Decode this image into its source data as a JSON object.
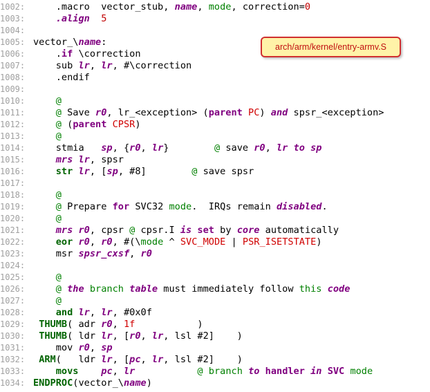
{
  "file_label": "arch/arm/kernel/entry-armv.S",
  "lines": [
    {
      "n": "1002:",
      "t": [
        [
          "p",
          "    .macro  vector_stub, "
        ],
        [
          "ri",
          "name"
        ],
        [
          "p",
          ", "
        ],
        [
          "g",
          "mode"
        ],
        [
          "p",
          ", correction="
        ],
        [
          "num",
          "0"
        ]
      ]
    },
    {
      "n": "1003:",
      "t": [
        [
          "p",
          "    "
        ],
        [
          "ri",
          ".align"
        ],
        [
          "p",
          "  "
        ],
        [
          "num",
          "5"
        ]
      ]
    },
    {
      "n": "1004:",
      "t": []
    },
    {
      "n": "1005:",
      "t": [
        [
          "p",
          "vector_\\"
        ],
        [
          "ri",
          "name"
        ],
        [
          "p",
          ":"
        ]
      ]
    },
    {
      "n": "1006:",
      "t": [
        [
          "p",
          "    ."
        ],
        [
          "pb",
          "if"
        ],
        [
          "p",
          " \\correction"
        ]
      ]
    },
    {
      "n": "1007:",
      "t": [
        [
          "p",
          "    sub "
        ],
        [
          "ri",
          "lr"
        ],
        [
          "p",
          ", "
        ],
        [
          "ri",
          "lr"
        ],
        [
          "p",
          ", #\\correction"
        ]
      ]
    },
    {
      "n": "1008:",
      "t": [
        [
          "p",
          "    .endif"
        ]
      ]
    },
    {
      "n": "1009:",
      "t": []
    },
    {
      "n": "1010:",
      "t": [
        [
          "p",
          "    "
        ],
        [
          "g",
          "@"
        ]
      ]
    },
    {
      "n": "1011:",
      "t": [
        [
          "p",
          "    "
        ],
        [
          "g",
          "@"
        ],
        [
          "p",
          " Save "
        ],
        [
          "ri",
          "r0"
        ],
        [
          "p",
          ", lr_<exception> ("
        ],
        [
          "pb",
          "parent"
        ],
        [
          "p",
          " "
        ],
        [
          "red",
          "PC"
        ],
        [
          "p",
          ") "
        ],
        [
          "ri",
          "and"
        ],
        [
          "p",
          " spsr_<exception>"
        ]
      ]
    },
    {
      "n": "1012:",
      "t": [
        [
          "p",
          "    "
        ],
        [
          "g",
          "@"
        ],
        [
          "p",
          " ("
        ],
        [
          "pb",
          "parent"
        ],
        [
          "p",
          " "
        ],
        [
          "red",
          "CPSR"
        ],
        [
          "p",
          ")"
        ]
      ]
    },
    {
      "n": "1013:",
      "t": [
        [
          "p",
          "    "
        ],
        [
          "g",
          "@"
        ]
      ]
    },
    {
      "n": "1014:",
      "t": [
        [
          "p",
          "    stmia   "
        ],
        [
          "ri",
          "sp"
        ],
        [
          "p",
          ", {"
        ],
        [
          "ri",
          "r0"
        ],
        [
          "p",
          ", "
        ],
        [
          "ri",
          "lr"
        ],
        [
          "p",
          "}        "
        ],
        [
          "g",
          "@"
        ],
        [
          "p",
          " save "
        ],
        [
          "ri",
          "r0"
        ],
        [
          "p",
          ", "
        ],
        [
          "ri",
          "lr"
        ],
        [
          "p",
          " "
        ],
        [
          "ri",
          "to"
        ],
        [
          "p",
          " "
        ],
        [
          "ri",
          "sp"
        ]
      ]
    },
    {
      "n": "1015:",
      "t": [
        [
          "p",
          "    "
        ],
        [
          "ri",
          "mrs"
        ],
        [
          "p",
          " "
        ],
        [
          "ri",
          "lr"
        ],
        [
          "p",
          ", spsr"
        ]
      ]
    },
    {
      "n": "1016:",
      "t": [
        [
          "p",
          "    "
        ],
        [
          "gb",
          "str"
        ],
        [
          "p",
          " "
        ],
        [
          "ri",
          "lr"
        ],
        [
          "p",
          ", ["
        ],
        [
          "ri",
          "sp"
        ],
        [
          "p",
          ", #8]        "
        ],
        [
          "g",
          "@"
        ],
        [
          "p",
          " save spsr"
        ]
      ]
    },
    {
      "n": "1017:",
      "t": []
    },
    {
      "n": "1018:",
      "t": [
        [
          "p",
          "    "
        ],
        [
          "g",
          "@"
        ]
      ]
    },
    {
      "n": "1019:",
      "t": [
        [
          "p",
          "    "
        ],
        [
          "g",
          "@"
        ],
        [
          "p",
          " Prepare "
        ],
        [
          "pb",
          "for"
        ],
        [
          "p",
          " SVC32 "
        ],
        [
          "g",
          "mode"
        ],
        [
          "p",
          ".  IRQs remain "
        ],
        [
          "ri",
          "disabled"
        ],
        [
          "p",
          "."
        ]
      ]
    },
    {
      "n": "1020:",
      "t": [
        [
          "p",
          "    "
        ],
        [
          "g",
          "@"
        ]
      ]
    },
    {
      "n": "1021:",
      "t": [
        [
          "p",
          "    "
        ],
        [
          "ri",
          "mrs"
        ],
        [
          "p",
          " "
        ],
        [
          "ri",
          "r0"
        ],
        [
          "p",
          ", cpsr "
        ],
        [
          "g",
          "@"
        ],
        [
          "p",
          " cpsr.I "
        ],
        [
          "ri",
          "is"
        ],
        [
          "p",
          " "
        ],
        [
          "pb",
          "set"
        ],
        [
          "p",
          " by "
        ],
        [
          "ri",
          "core"
        ],
        [
          "p",
          " automatically"
        ]
      ]
    },
    {
      "n": "1022:",
      "t": [
        [
          "p",
          "    "
        ],
        [
          "gb",
          "eor"
        ],
        [
          "p",
          " "
        ],
        [
          "ri",
          "r0"
        ],
        [
          "p",
          ", "
        ],
        [
          "ri",
          "r0"
        ],
        [
          "p",
          ", #(\\"
        ],
        [
          "g",
          "mode"
        ],
        [
          "p",
          " ^ "
        ],
        [
          "red",
          "SVC_MODE"
        ],
        [
          "p",
          " | "
        ],
        [
          "red",
          "PSR_ISETSTATE"
        ],
        [
          "p",
          ")"
        ]
      ]
    },
    {
      "n": "1023:",
      "t": [
        [
          "p",
          "    msr "
        ],
        [
          "ri",
          "spsr_cxsf"
        ],
        [
          "p",
          ", "
        ],
        [
          "ri",
          "r0"
        ]
      ]
    },
    {
      "n": "1024:",
      "t": []
    },
    {
      "n": "1025:",
      "t": [
        [
          "p",
          "    "
        ],
        [
          "g",
          "@"
        ]
      ]
    },
    {
      "n": "1026:",
      "t": [
        [
          "p",
          "    "
        ],
        [
          "g",
          "@"
        ],
        [
          "p",
          " "
        ],
        [
          "ri",
          "the"
        ],
        [
          "p",
          " "
        ],
        [
          "g",
          "branch"
        ],
        [
          "p",
          " "
        ],
        [
          "ri",
          "table"
        ],
        [
          "p",
          " must immediately follow "
        ],
        [
          "g",
          "this"
        ],
        [
          "p",
          " "
        ],
        [
          "ri",
          "code"
        ]
      ]
    },
    {
      "n": "1027:",
      "t": [
        [
          "p",
          "    "
        ],
        [
          "g",
          "@"
        ]
      ]
    },
    {
      "n": "1028:",
      "t": [
        [
          "p",
          "    "
        ],
        [
          "gb",
          "and"
        ],
        [
          "p",
          " "
        ],
        [
          "ri",
          "lr"
        ],
        [
          "p",
          ", "
        ],
        [
          "ri",
          "lr"
        ],
        [
          "p",
          ", #0x0f"
        ]
      ]
    },
    {
      "n": "1029:",
      "t": [
        [
          "p",
          " "
        ],
        [
          "gb",
          "THUMB"
        ],
        [
          "p",
          "( adr "
        ],
        [
          "ri",
          "r0"
        ],
        [
          "p",
          ", "
        ],
        [
          "red",
          "1f"
        ],
        [
          "p",
          "           )"
        ]
      ]
    },
    {
      "n": "1030:",
      "t": [
        [
          "p",
          " "
        ],
        [
          "gb",
          "THUMB"
        ],
        [
          "p",
          "( ldr "
        ],
        [
          "ri",
          "lr"
        ],
        [
          "p",
          ", ["
        ],
        [
          "ri",
          "r0"
        ],
        [
          "p",
          ", "
        ],
        [
          "ri",
          "lr"
        ],
        [
          "p",
          ", lsl #2]    )"
        ]
      ]
    },
    {
      "n": "1031:",
      "t": [
        [
          "p",
          "    mov "
        ],
        [
          "ri",
          "r0"
        ],
        [
          "p",
          ", "
        ],
        [
          "ri",
          "sp"
        ]
      ]
    },
    {
      "n": "1032:",
      "t": [
        [
          "p",
          " "
        ],
        [
          "gb",
          "ARM"
        ],
        [
          "p",
          "(   ldr "
        ],
        [
          "ri",
          "lr"
        ],
        [
          "p",
          ", ["
        ],
        [
          "ri",
          "pc"
        ],
        [
          "p",
          ", "
        ],
        [
          "ri",
          "lr"
        ],
        [
          "p",
          ", lsl #2]    )"
        ]
      ]
    },
    {
      "n": "1033:",
      "t": [
        [
          "p",
          "    "
        ],
        [
          "gb",
          "movs"
        ],
        [
          "p",
          "    "
        ],
        [
          "ri",
          "pc"
        ],
        [
          "p",
          ", "
        ],
        [
          "ri",
          "lr"
        ],
        [
          "p",
          "           "
        ],
        [
          "g",
          "@"
        ],
        [
          "p",
          " "
        ],
        [
          "g",
          "branch"
        ],
        [
          "p",
          " "
        ],
        [
          "ri",
          "to"
        ],
        [
          "p",
          " "
        ],
        [
          "pb",
          "handler"
        ],
        [
          "p",
          " "
        ],
        [
          "ri",
          "in"
        ],
        [
          "p",
          " "
        ],
        [
          "pb",
          "SVC"
        ],
        [
          "p",
          " "
        ],
        [
          "g",
          "mode"
        ]
      ]
    },
    {
      "n": "1034:",
      "t": [
        [
          "gb",
          "ENDPROC"
        ],
        [
          "p",
          "(vector_\\"
        ],
        [
          "ri",
          "name"
        ],
        [
          "p",
          ")"
        ]
      ]
    }
  ],
  "colors": {
    "line_number": "#a0a0a0",
    "comment": "#008000",
    "register": "#800080",
    "number": "#c00000",
    "badge_border": "#d03030",
    "badge_bg": "#fff3a8"
  }
}
